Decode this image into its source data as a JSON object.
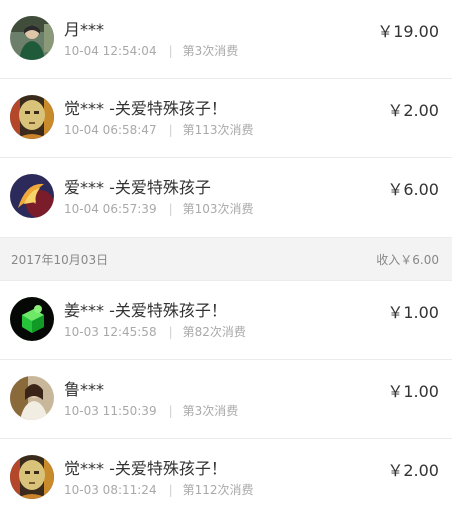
{
  "records_top": [
    {
      "name": "月***",
      "time": "10-04 12:54:04",
      "count": "第3次消费",
      "amount": "￥19.00",
      "avatar_icon": "person-portrait-icon"
    },
    {
      "name": "觉*** -关爱特殊孩子！",
      "time": "10-04 06:58:47",
      "count": "第113次消费",
      "amount": "￥2.00",
      "avatar_icon": "mask-face-icon"
    },
    {
      "name": "爱*** -关爱特殊孩子",
      "time": "10-04 06:57:39",
      "count": "第103次消费",
      "amount": "￥6.00",
      "avatar_icon": "phoenix-icon"
    }
  ],
  "day_header": {
    "date": "2017年10月03日",
    "income": "收入￥6.00"
  },
  "records_bottom": [
    {
      "name": "姜*** -关爱特殊孩子！",
      "time": "10-03 12:45:58",
      "count": "第82次消费",
      "amount": "￥1.00",
      "avatar_icon": "green-cube-icon"
    },
    {
      "name": "鲁***",
      "time": "10-03 11:50:39",
      "count": "第3次消费",
      "amount": "￥1.00",
      "avatar_icon": "person-portrait-icon"
    },
    {
      "name": "觉*** -关爱特殊孩子！",
      "time": "10-03 08:11:24",
      "count": "第112次消费",
      "amount": "￥2.00",
      "avatar_icon": "mask-face-icon"
    }
  ],
  "separator": "|"
}
